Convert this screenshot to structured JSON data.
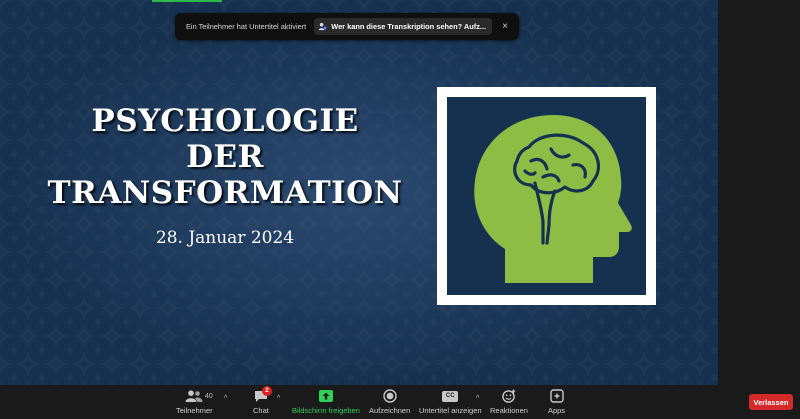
{
  "banner": {
    "text": "Ein Teilnehmer hat Untertitel aktiviert",
    "link": "Wer kann diese Transkription sehen? Aufz...",
    "close": "×"
  },
  "slide": {
    "title_lines": [
      "PSYCHOLOGIE",
      "DER",
      "TRANSFORMATION"
    ],
    "date": "28. Januar 2024",
    "icon_color": "#8ebd45"
  },
  "toolbar": {
    "participants": {
      "label": "Teilnehmer",
      "count": "40"
    },
    "chat": {
      "label": "Chat",
      "badge": "2"
    },
    "share": {
      "label": "Bildschirm freigeben"
    },
    "record": {
      "label": "Aufzeichnen"
    },
    "captions": {
      "label": "Untertitel anzeigen",
      "icon_text": "CC"
    },
    "reactions": {
      "label": "Reaktionen"
    },
    "apps": {
      "label": "Apps"
    },
    "leave": {
      "label": "Verlassen"
    },
    "caret": "^"
  },
  "colors": {
    "accent_green": "#2fd058",
    "leave_red": "#d42a2a"
  }
}
